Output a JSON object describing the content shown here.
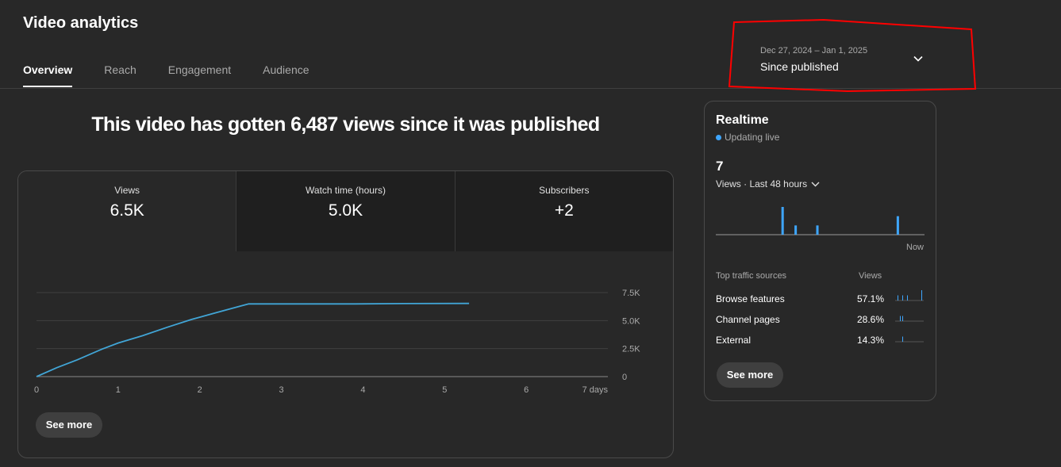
{
  "header": {
    "title": "Video analytics",
    "tabs": [
      {
        "label": "Overview",
        "active": true
      },
      {
        "label": "Reach",
        "active": false
      },
      {
        "label": "Engagement",
        "active": false
      },
      {
        "label": "Audience",
        "active": false
      }
    ]
  },
  "date_picker": {
    "range": "Dec 27, 2024 – Jan 1, 2025",
    "preset": "Since published",
    "icon": "chevron-down-icon"
  },
  "overview": {
    "headline": "This video has gotten 6,487 views since it was published",
    "metrics": [
      {
        "label": "Views",
        "value": "6.5K",
        "selected": true
      },
      {
        "label": "Watch time (hours)",
        "value": "5.0K",
        "selected": false
      },
      {
        "label": "Subscribers",
        "value": "+2",
        "selected": false
      }
    ],
    "see_more": "See more"
  },
  "chart_data": {
    "type": "line",
    "title": "",
    "xlabel": "",
    "ylabel": "",
    "x_ticks": [
      "0",
      "1",
      "2",
      "3",
      "4",
      "5",
      "6",
      "7 days"
    ],
    "y_ticks": [
      "0",
      "2.5K",
      "5.0K",
      "7.5K"
    ],
    "xlim": [
      0,
      7
    ],
    "ylim": [
      0,
      7500
    ],
    "grid": true,
    "color": "#41a5d6",
    "series": [
      {
        "x": [
          0,
          0.25,
          0.5,
          0.8,
          1.0,
          1.3,
          1.6,
          1.9,
          2.2,
          2.5,
          2.6,
          3.5,
          3.9,
          4.5,
          5.3
        ],
        "y": [
          0,
          800,
          1500,
          2450,
          3000,
          3650,
          4400,
          5100,
          5700,
          6300,
          6487,
          6487,
          6487,
          6520,
          6530
        ]
      }
    ]
  },
  "realtime": {
    "title": "Realtime",
    "status": "Updating live",
    "count": "7",
    "views_label": "Views · Last 48 hours",
    "now_label": "Now",
    "hourly_views": [
      0,
      0,
      0,
      0,
      0,
      0,
      0,
      0,
      0,
      0,
      0,
      0,
      0,
      0,
      0,
      0,
      0,
      0,
      0,
      0,
      0,
      0,
      0,
      0,
      0,
      0,
      0,
      0,
      0,
      0,
      3,
      0,
      0,
      0,
      0,
      0,
      1,
      0,
      0,
      0,
      0,
      0,
      0,
      0,
      0,
      0,
      1,
      0,
      0,
      0,
      0,
      0,
      0,
      0,
      0,
      0,
      0,
      0,
      0,
      0,
      0,
      0,
      0,
      0,
      0,
      0,
      0,
      0,
      0,
      0,
      0,
      0,
      0,
      0,
      0,
      0,
      0,
      0,
      0,
      0,
      0,
      0,
      0,
      2,
      0,
      0,
      0,
      0,
      0,
      0,
      0,
      0,
      0,
      0,
      0,
      0
    ],
    "traffic_header": "Top traffic sources",
    "traffic_views_header": "Views",
    "traffic": [
      {
        "name": "Browse features",
        "pct": "57.1%",
        "spark": [
          0,
          0,
          1,
          0,
          0,
          0,
          1,
          0,
          0,
          0,
          1,
          0,
          0,
          0,
          0,
          0,
          0,
          0,
          0,
          0,
          0,
          0,
          2,
          0
        ]
      },
      {
        "name": "Channel pages",
        "pct": "28.6%",
        "spark": [
          0,
          0,
          0,
          0,
          1,
          0,
          1,
          0,
          0,
          0,
          0,
          0,
          0,
          0,
          0,
          0,
          0,
          0,
          0,
          0,
          0,
          0,
          0,
          0
        ]
      },
      {
        "name": "External",
        "pct": "14.3%",
        "spark": [
          0,
          0,
          0,
          0,
          0,
          0,
          1,
          0,
          0,
          0,
          0,
          0,
          0,
          0,
          0,
          0,
          0,
          0,
          0,
          0,
          0,
          0,
          0,
          0
        ]
      }
    ],
    "see_more": "See more"
  },
  "colors": {
    "background": "#282828",
    "accent": "#3ea6ff",
    "line": "#41a5d6",
    "annotation": "#ff0000"
  }
}
